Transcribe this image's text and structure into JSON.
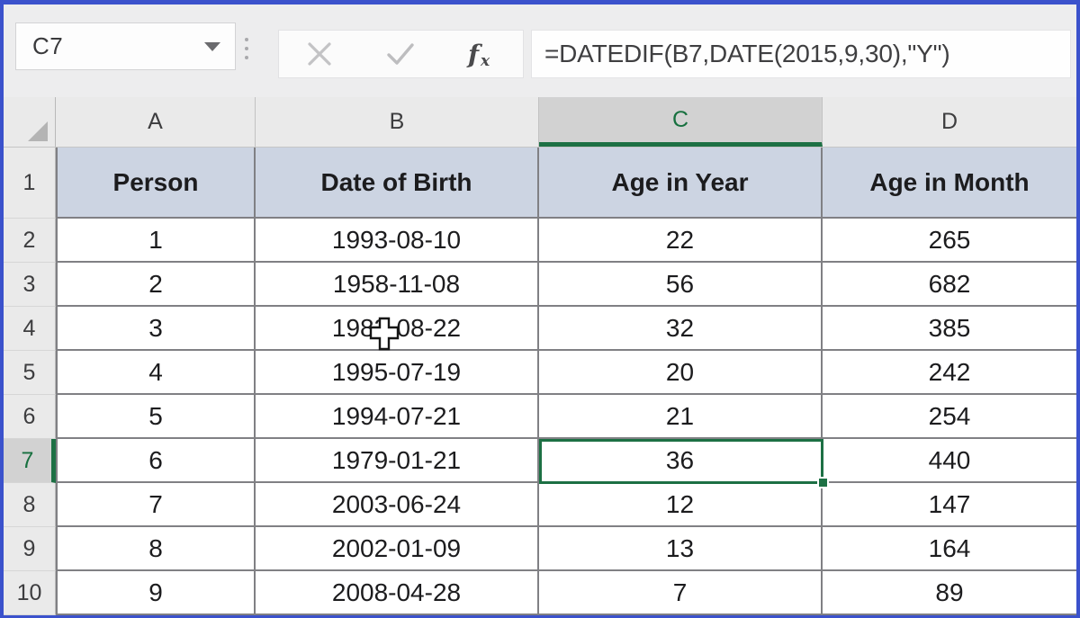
{
  "window": {
    "border_color": "#3b52cc",
    "app": "Microsoft Excel"
  },
  "formula_bar": {
    "name_box_label": "Name Box",
    "name_box_value": "C7",
    "cancel_label": "Cancel",
    "enter_label": "Enter",
    "insert_function_label": "fx",
    "formula": "=DATEDIF(B7,DATE(2015,9,30),\"Y\")",
    "formula_placeholder": ""
  },
  "grid": {
    "column_headers": [
      "A",
      "B",
      "C",
      "D"
    ],
    "selected_column": "C",
    "row_headers": [
      "1",
      "2",
      "3",
      "4",
      "5",
      "6",
      "7",
      "8",
      "9",
      "10"
    ],
    "selected_row": "7",
    "active_cell": "C7",
    "selection_color": "#1d7044",
    "header_fill": "#ccd4e2",
    "table_headers": [
      "Person",
      "Date of Birth",
      "Age in Year",
      "Age in Month"
    ],
    "rows": [
      {
        "person": "1",
        "dob": "1993-08-10",
        "age_year": "22",
        "age_month": "265"
      },
      {
        "person": "2",
        "dob": "1958-11-08",
        "age_year": "56",
        "age_month": "682"
      },
      {
        "person": "3",
        "dob": "1983-08-22",
        "age_year": "32",
        "age_month": "385"
      },
      {
        "person": "4",
        "dob": "1995-07-19",
        "age_year": "20",
        "age_month": "242"
      },
      {
        "person": "5",
        "dob": "1994-07-21",
        "age_year": "21",
        "age_month": "254"
      },
      {
        "person": "6",
        "dob": "1979-01-21",
        "age_year": "36",
        "age_month": "440"
      },
      {
        "person": "7",
        "dob": "2003-06-24",
        "age_year": "12",
        "age_month": "147"
      },
      {
        "person": "8",
        "dob": "2002-01-09",
        "age_year": "13",
        "age_month": "164"
      },
      {
        "person": "9",
        "dob": "2008-04-28",
        "age_year": "7",
        "age_month": "89"
      }
    ]
  }
}
